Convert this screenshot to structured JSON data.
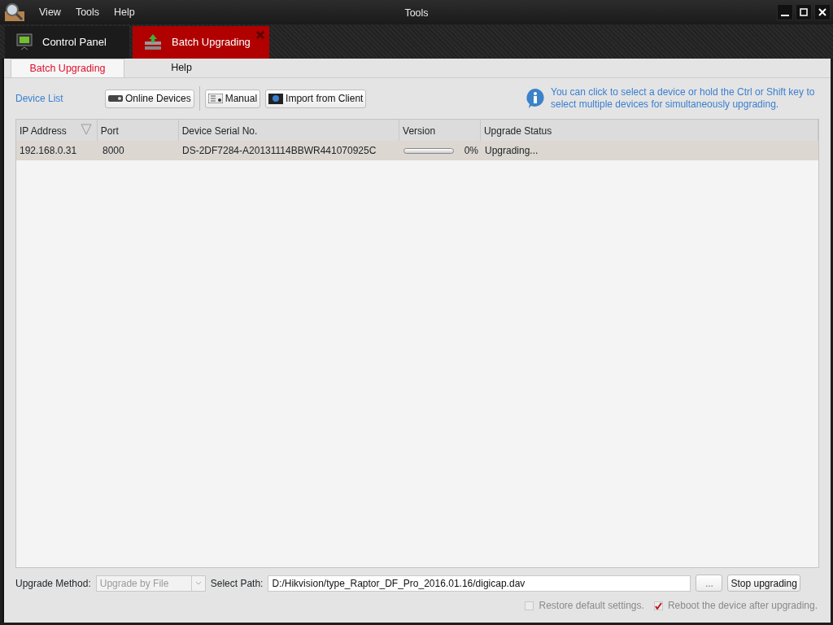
{
  "window": {
    "title": "Tools"
  },
  "menu": [
    "View",
    "Tools",
    "Help"
  ],
  "app_tabs": [
    {
      "label": "Control Panel",
      "kind": "panel",
      "selected": false
    },
    {
      "label": "Batch Upgrading",
      "kind": "upgrade",
      "selected": true
    }
  ],
  "sub_tabs": [
    {
      "label": "Batch Upgrading",
      "selected": true
    },
    {
      "label": "Help",
      "selected": false
    }
  ],
  "toolbar": {
    "title": "Device List",
    "buttons": [
      {
        "label": "Online Devices",
        "kind": "online"
      },
      {
        "label": "Manual",
        "kind": "manual"
      },
      {
        "label": "Import from Client",
        "kind": "import"
      }
    ],
    "hint": "You can click to select a device or hold the Ctrl or Shift key to select multiple devices for simultaneously upgrading."
  },
  "table": {
    "columns": [
      "IP Address",
      "Port",
      "Device Serial No.",
      "Version",
      "Upgrade Status"
    ],
    "rows": [
      {
        "ip": "192.168.0.31",
        "port": "8000",
        "serial": "DS-2DF7284-A20131114BBWR441070925C",
        "level": 0,
        "percent": "0%",
        "status": "Upgrading...",
        "selected": true
      }
    ]
  },
  "footer": {
    "method_label": "Upgrade Method:",
    "method_value": "Upgrade by File",
    "method_disabled": true,
    "path_label": "Select Path:",
    "path_value": "D:/Hikvision/type_Raptor_DF_Pro_2016.01.16/digicap.dav",
    "browse_label": "...",
    "stop_label": "Stop upgrading",
    "options": [
      {
        "label": "Restore default settings.",
        "checked": false,
        "disabled": true
      },
      {
        "label": "Reboot the device after upgrading.",
        "checked": true,
        "disabled": true
      }
    ]
  }
}
